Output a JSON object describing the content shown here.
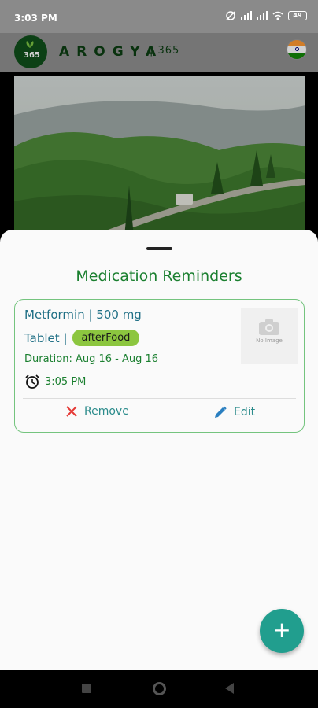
{
  "status_bar": {
    "time": "3:03 PM",
    "battery": "49"
  },
  "app_bar": {
    "logo_text": "365",
    "brand": "AROGYA",
    "brand_sub": "| 365",
    "flag_colors": [
      "#ff9933",
      "#ffffff",
      "#138808"
    ]
  },
  "sheet": {
    "title": "Medication Reminders"
  },
  "reminder": {
    "name_dose": "Metformin | 500 mg",
    "form": "Tablet |",
    "timing": "afterFood",
    "duration": "Duration: Aug 16 - Aug 16",
    "time": "3:05 PM",
    "no_image": "No Image",
    "remove_label": "Remove",
    "edit_label": "Edit"
  },
  "fab": {
    "label": "+"
  },
  "colors": {
    "accent_green": "#1a7f2f",
    "teal": "#219e8e",
    "pill": "#8cc63f",
    "remove_red": "#e53935"
  }
}
